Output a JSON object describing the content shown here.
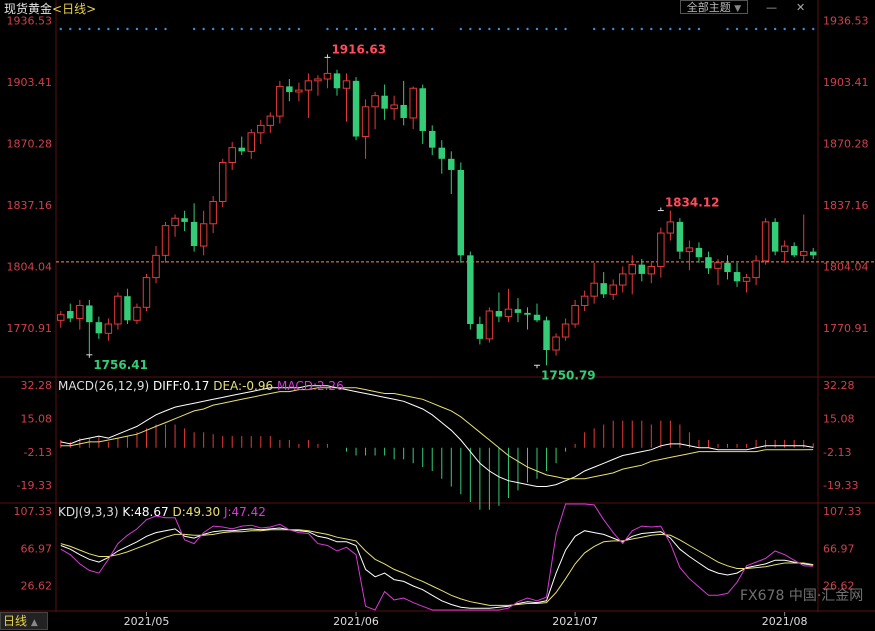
{
  "header": {
    "title": "现货黄金",
    "period": "<日线>",
    "theme_button": "全部主题",
    "theme_arrow": "▼",
    "ctrl_minus": "—",
    "ctrl_close": "✕"
  },
  "period_tab": {
    "label": "日线",
    "arrow": "▲"
  },
  "watermark": {
    "text": "FX678 中国·汇金网"
  },
  "colors": {
    "up": "#e33a3a",
    "down": "#33cc77",
    "diff_line": "#ffffff",
    "dea_line": "#e8e070",
    "macd_bar_pos": "#e33a3a",
    "macd_bar_neg": "#33cc77",
    "k_line": "#ffffff",
    "d_line": "#e8e070",
    "j_line": "#d63ad6",
    "axis_text": "#d0404a",
    "price_line": "#ff8c40",
    "dots": "#3a8fdd"
  },
  "chart_data": [
    {
      "type": "candlestick",
      "title": "现货黄金<日线>",
      "ylim": [
        1745,
        1940
      ],
      "y_ticks": [
        "1936.53",
        "1903.41",
        "1870.28",
        "1837.16",
        "1804.04",
        "1770.91"
      ],
      "x_ticks": [
        "2021/05",
        "2021/06",
        "2021/07",
        "2021/08"
      ],
      "x_tick_index": [
        9,
        31,
        54,
        76
      ],
      "annotations": [
        {
          "label": "1916.63",
          "index": 28,
          "value": 1916.63,
          "kind": "high"
        },
        {
          "label": "1834.12",
          "index": 63,
          "value": 1834.12,
          "kind": "high"
        },
        {
          "label": "1756.41",
          "index": 3,
          "value": 1756.41,
          "kind": "low"
        },
        {
          "label": "1750.79",
          "index": 50,
          "value": 1750.79,
          "kind": "low"
        }
      ],
      "current_price": 1806.5,
      "ohlc": [
        [
          1775,
          1780,
          1771,
          1778
        ],
        [
          1780,
          1784,
          1774,
          1776
        ],
        [
          1776,
          1786,
          1770,
          1783
        ],
        [
          1783,
          1786,
          1756.41,
          1774
        ],
        [
          1774,
          1777,
          1765,
          1768
        ],
        [
          1768,
          1776,
          1764,
          1773
        ],
        [
          1773,
          1790,
          1770,
          1788
        ],
        [
          1788,
          1792,
          1773,
          1775
        ],
        [
          1775,
          1784,
          1773,
          1782
        ],
        [
          1782,
          1800,
          1780,
          1798
        ],
        [
          1798,
          1815,
          1795,
          1810
        ],
        [
          1810,
          1828,
          1806,
          1826
        ],
        [
          1826,
          1832,
          1820,
          1830
        ],
        [
          1830,
          1834,
          1823,
          1828
        ],
        [
          1828,
          1838,
          1812,
          1815
        ],
        [
          1815,
          1834,
          1810,
          1827
        ],
        [
          1827,
          1842,
          1822,
          1839
        ],
        [
          1839,
          1862,
          1836,
          1860
        ],
        [
          1860,
          1871,
          1856,
          1868
        ],
        [
          1868,
          1874,
          1864,
          1866
        ],
        [
          1866,
          1878,
          1862,
          1876
        ],
        [
          1876,
          1883,
          1870,
          1880
        ],
        [
          1880,
          1887,
          1876,
          1885
        ],
        [
          1885,
          1904,
          1881,
          1901
        ],
        [
          1901,
          1905,
          1893,
          1898
        ],
        [
          1898,
          1903,
          1893,
          1899
        ],
        [
          1899,
          1908,
          1884,
          1904
        ],
        [
          1904,
          1907,
          1896,
          1905
        ],
        [
          1905,
          1916.63,
          1900,
          1908
        ],
        [
          1908,
          1910,
          1896,
          1900
        ],
        [
          1900,
          1908,
          1882,
          1904
        ],
        [
          1904,
          1906,
          1872,
          1874
        ],
        [
          1874,
          1894,
          1862,
          1890
        ],
        [
          1890,
          1898,
          1878,
          1896
        ],
        [
          1896,
          1902,
          1883,
          1889
        ],
        [
          1889,
          1896,
          1883,
          1891
        ],
        [
          1891,
          1904,
          1880,
          1884
        ],
        [
          1884,
          1901,
          1878,
          1900
        ],
        [
          1900,
          1902,
          1870,
          1877
        ],
        [
          1877,
          1880,
          1864,
          1868
        ],
        [
          1868,
          1872,
          1854,
          1862
        ],
        [
          1862,
          1866,
          1843,
          1856
        ],
        [
          1856,
          1860,
          1806,
          1810
        ],
        [
          1810,
          1812,
          1770,
          1773
        ],
        [
          1773,
          1777,
          1762,
          1765
        ],
        [
          1765,
          1782,
          1763,
          1780
        ],
        [
          1780,
          1790,
          1774,
          1777
        ],
        [
          1777,
          1792,
          1774,
          1781
        ],
        [
          1781,
          1787,
          1774,
          1779
        ],
        [
          1779,
          1782,
          1770,
          1778
        ],
        [
          1778,
          1784,
          1774,
          1775
        ],
        [
          1775,
          1777,
          1750.79,
          1759
        ],
        [
          1759,
          1768,
          1756,
          1766
        ],
        [
          1766,
          1776,
          1764,
          1773
        ],
        [
          1773,
          1786,
          1771,
          1783
        ],
        [
          1783,
          1791,
          1780,
          1788
        ],
        [
          1788,
          1806,
          1784,
          1795
        ],
        [
          1795,
          1801,
          1787,
          1789
        ],
        [
          1789,
          1797,
          1786,
          1794
        ],
        [
          1794,
          1804,
          1790,
          1800
        ],
        [
          1800,
          1810,
          1789,
          1805
        ],
        [
          1805,
          1808,
          1796,
          1800
        ],
        [
          1800,
          1806,
          1795,
          1804
        ],
        [
          1804,
          1825,
          1798,
          1822
        ],
        [
          1822,
          1834.12,
          1818,
          1828
        ],
        [
          1828,
          1830,
          1808,
          1812
        ],
        [
          1812,
          1818,
          1802,
          1814
        ],
        [
          1814,
          1817,
          1806,
          1809
        ],
        [
          1809,
          1812,
          1800,
          1803
        ],
        [
          1803,
          1808,
          1794,
          1806
        ],
        [
          1806,
          1810,
          1797,
          1801
        ],
        [
          1801,
          1806,
          1793,
          1796
        ],
        [
          1796,
          1800,
          1790,
          1798
        ],
        [
          1798,
          1810,
          1794,
          1807
        ],
        [
          1807,
          1830,
          1805,
          1828
        ],
        [
          1828,
          1830,
          1810,
          1812
        ],
        [
          1812,
          1818,
          1806,
          1815
        ],
        [
          1815,
          1817,
          1809,
          1810
        ],
        [
          1810,
          1832,
          1806,
          1812
        ],
        [
          1812,
          1814,
          1808,
          1810
        ]
      ]
    },
    {
      "type": "line",
      "title": "MACD(26,12,9)",
      "readouts": {
        "diff": "DIFF:0.17",
        "dea": "DEA:-0.96",
        "macd": "MACD:2.26"
      },
      "ylim": [
        -28,
        36
      ],
      "y_ticks": [
        "32.28",
        "15.08",
        "-2.13",
        "-19.33"
      ],
      "series": [
        {
          "name": "DIFF",
          "values": [
            3,
            2,
            4,
            5,
            6,
            5,
            7,
            9,
            11,
            14,
            17,
            19,
            21,
            22,
            23,
            24,
            25,
            26,
            27,
            28,
            29,
            30,
            31,
            31,
            31,
            31,
            32,
            32,
            32,
            31,
            30,
            29,
            28,
            27,
            26,
            25,
            24,
            22,
            20,
            17,
            13,
            9,
            4,
            -2,
            -8,
            -12,
            -15,
            -17,
            -18,
            -19,
            -20,
            -20,
            -19,
            -17,
            -15,
            -12,
            -10,
            -8,
            -6,
            -4,
            -3,
            -2,
            -1,
            1,
            2,
            2,
            1,
            0,
            0,
            -1,
            -1,
            -1,
            -1,
            0,
            1,
            1,
            1,
            1,
            1,
            0.17
          ]
        },
        {
          "name": "DEA",
          "values": [
            1,
            1,
            2,
            3,
            3,
            4,
            5,
            6,
            7,
            9,
            11,
            13,
            15,
            17,
            19,
            20,
            22,
            23,
            24,
            25,
            26,
            27,
            28,
            29,
            29,
            30,
            30,
            31,
            31,
            31,
            31,
            31,
            30,
            29,
            28,
            28,
            27,
            26,
            25,
            23,
            21,
            19,
            16,
            12,
            8,
            4,
            0,
            -4,
            -7,
            -10,
            -12,
            -14,
            -15,
            -16,
            -16,
            -16,
            -15,
            -14,
            -13,
            -11,
            -10,
            -9,
            -7,
            -6,
            -5,
            -4,
            -3,
            -2,
            -2,
            -2,
            -2,
            -2,
            -2,
            -2,
            -1,
            -1,
            -1,
            -1,
            -1,
            -0.96
          ]
        },
        {
          "name": "MACD",
          "values": [
            4,
            3,
            5,
            5,
            6,
            3,
            5,
            6,
            8,
            10,
            12,
            12,
            12,
            10,
            8,
            8,
            7,
            6,
            6,
            6,
            6,
            6,
            6,
            4,
            4,
            2,
            4,
            2,
            2,
            0,
            -2,
            -4,
            -4,
            -4,
            -4,
            -6,
            -6,
            -8,
            -10,
            -12,
            -16,
            -20,
            -24,
            -28,
            -32,
            -32,
            -30,
            -26,
            -22,
            -18,
            -16,
            -12,
            -8,
            -2,
            2,
            8,
            10,
            12,
            14,
            14,
            14,
            14,
            12,
            14,
            14,
            12,
            8,
            4,
            4,
            2,
            2,
            2,
            2,
            4,
            4,
            4,
            4,
            4,
            4,
            2.26
          ]
        }
      ]
    },
    {
      "type": "line",
      "title": "KDJ(9,3,3)",
      "readouts": {
        "k": "K:48.67",
        "d": "D:49.30",
        "j": "J:47.42"
      },
      "ylim": [
        0,
        115
      ],
      "y_ticks": [
        "107.33",
        "66.97",
        "26.62"
      ],
      "series": [
        {
          "name": "K",
          "values": [
            70,
            66,
            60,
            55,
            52,
            57,
            64,
            69,
            74,
            80,
            84,
            86,
            88,
            80,
            78,
            82,
            85,
            86,
            86,
            87,
            88,
            87,
            88,
            89,
            87,
            86,
            85,
            80,
            78,
            74,
            74,
            70,
            44,
            36,
            40,
            33,
            31,
            26,
            22,
            16,
            10,
            6,
            3,
            2,
            2,
            2,
            3,
            4,
            7,
            9,
            8,
            10,
            40,
            65,
            80,
            86,
            84,
            82,
            78,
            74,
            80,
            83,
            84,
            85,
            78,
            66,
            58,
            51,
            44,
            40,
            38,
            40,
            46,
            48,
            50,
            54,
            54,
            52,
            50,
            48.67
          ]
        },
        {
          "name": "D",
          "values": [
            72,
            69,
            65,
            61,
            58,
            58,
            60,
            63,
            67,
            71,
            75,
            79,
            82,
            82,
            81,
            81,
            82,
            84,
            85,
            85,
            86,
            86,
            87,
            87,
            87,
            87,
            86,
            84,
            82,
            79,
            77,
            75,
            64,
            55,
            50,
            44,
            40,
            35,
            31,
            26,
            21,
            16,
            12,
            9,
            7,
            5,
            5,
            5,
            6,
            7,
            7,
            8,
            19,
            34,
            50,
            62,
            69,
            74,
            75,
            75,
            77,
            79,
            81,
            82,
            81,
            76,
            70,
            64,
            58,
            52,
            48,
            45,
            45,
            46,
            47,
            49,
            51,
            51,
            51,
            49.3
          ]
        },
        {
          "name": "J",
          "values": [
            66,
            60,
            50,
            43,
            40,
            55,
            72,
            81,
            88,
            98,
            102,
            100,
            100,
            76,
            72,
            84,
            91,
            90,
            88,
            91,
            92,
            89,
            90,
            93,
            87,
            84,
            83,
            72,
            70,
            64,
            68,
            60,
            4,
            -2,
            20,
            11,
            13,
            8,
            4,
            -4,
            -12,
            -14,
            -15,
            -12,
            -8,
            -4,
            -1,
            2,
            9,
            13,
            10,
            14,
            82,
            127,
            140,
            134,
            114,
            98,
            84,
            72,
            86,
            91,
            90,
            91,
            72,
            46,
            34,
            25,
            16,
            16,
            18,
            30,
            48,
            52,
            56,
            64,
            60,
            54,
            48,
            47.42
          ]
        }
      ]
    }
  ]
}
